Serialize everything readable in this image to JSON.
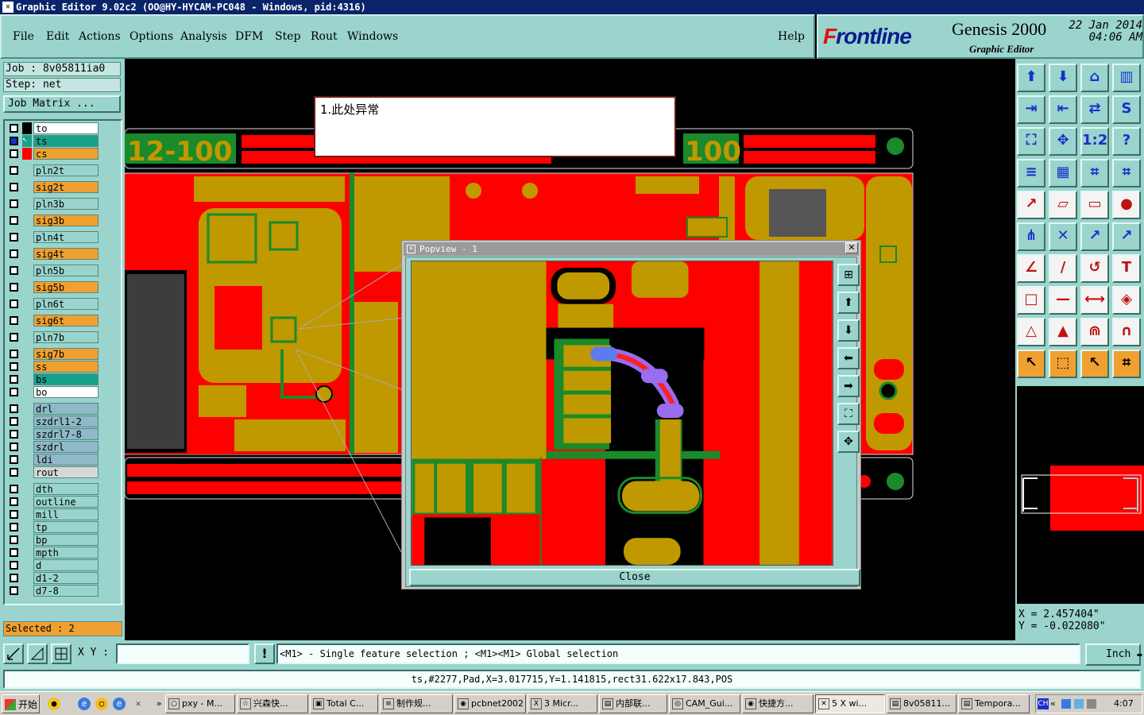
{
  "window": {
    "title": "Graphic Editor 9.02c2 (OO@HY-HYCAM-PC048 - Windows, pid:4316)"
  },
  "menu": [
    "File",
    "Edit",
    "Actions",
    "Options",
    "Analysis",
    "DFM",
    "Step",
    "Rout",
    "Windows"
  ],
  "help_label": "Help",
  "brand": {
    "logo_prefix": "F",
    "logo_rest": "rontline",
    "product": "Genesis 2000",
    "subtitle": "Graphic Editor",
    "date": "22 Jan 2014",
    "time": "04:06 AM"
  },
  "job": {
    "job_label": "Job : 8v05811ia0",
    "step_label": "Step: net",
    "matrix_button": "Job Matrix ..."
  },
  "layers": [
    {
      "name": "to",
      "color": "#ffffff"
    },
    {
      "name": "ts",
      "color": "#1aa08a",
      "selected": true
    },
    {
      "name": "cs",
      "color": "#f0a030"
    },
    {
      "name": "pln2t",
      "color": "#9ad4cc"
    },
    {
      "name": "sig2t",
      "color": "#f0a030"
    },
    {
      "name": "pln3b",
      "color": "#9ad4cc"
    },
    {
      "name": "sig3b",
      "color": "#f0a030"
    },
    {
      "name": "pln4t",
      "color": "#9ad4cc"
    },
    {
      "name": "sig4t",
      "color": "#f0a030"
    },
    {
      "name": "pln5b",
      "color": "#9ad4cc"
    },
    {
      "name": "sig5b",
      "color": "#f0a030"
    },
    {
      "name": "pln6t",
      "color": "#9ad4cc"
    },
    {
      "name": "sig6t",
      "color": "#f0a030"
    },
    {
      "name": "pln7b",
      "color": "#9ad4cc"
    },
    {
      "name": "sig7b",
      "color": "#f0a030"
    },
    {
      "name": "ss",
      "color": "#f0a030"
    },
    {
      "name": "bs",
      "color": "#1aa08a"
    },
    {
      "name": "bo",
      "color": "#ffffff"
    },
    {
      "name": "drl",
      "color": "#8fb8c8"
    },
    {
      "name": "szdrl1-2",
      "color": "#8fb8c8"
    },
    {
      "name": "szdrl7-8",
      "color": "#8fb8c8"
    },
    {
      "name": "szdrl",
      "color": "#8fb8c8"
    },
    {
      "name": "ldi",
      "color": "#8fb8c8"
    },
    {
      "name": "rout",
      "color": "#d8d8d8"
    },
    {
      "name": "dth",
      "color": "#9ad4cc"
    },
    {
      "name": "outline",
      "color": "#9ad4cc"
    },
    {
      "name": "mill",
      "color": "#9ad4cc"
    },
    {
      "name": "tp",
      "color": "#9ad4cc"
    },
    {
      "name": "bp",
      "color": "#9ad4cc"
    },
    {
      "name": "mpth",
      "color": "#9ad4cc"
    },
    {
      "name": "d",
      "color": "#9ad4cc"
    },
    {
      "name": "d1-2",
      "color": "#9ad4cc"
    },
    {
      "name": "d7-8",
      "color": "#9ad4cc"
    }
  ],
  "selected_text": "Selected : 2",
  "annotation": "1.此处异常",
  "board_text": {
    "left": "12-100",
    "right": "100"
  },
  "popview": {
    "title": "Popview - 1",
    "close_label": "Close"
  },
  "coords": {
    "x": "X = 2.457404\"",
    "y": "Y = -0.022080\""
  },
  "xy_label": "X Y :",
  "xy_value": "",
  "prompt": "<M1> - Single feature selection ; <M1><M1> Global selection",
  "unit": "Inch",
  "status": "ts,#2277,Pad,X=3.017715,Y=1.141815,rect31.622x17.843,POS",
  "taskbar": {
    "start": "开始",
    "tasks": [
      "pxy - M...",
      "兴森快...",
      "Total C...",
      "制作规...",
      "pcbnet2002",
      "3 Micr...",
      "内部联...",
      "CAM_Gui...",
      "快捷方...",
      "5 X wi...",
      "8v05811...",
      "Tempora..."
    ],
    "clock": "4:07",
    "ime": "CH"
  },
  "colors": {
    "top_copper": "#ff0000",
    "pad": "#c09800",
    "board": "#000000",
    "panel": "#9ad4cc",
    "selected_feature": "#9a6cf0"
  }
}
